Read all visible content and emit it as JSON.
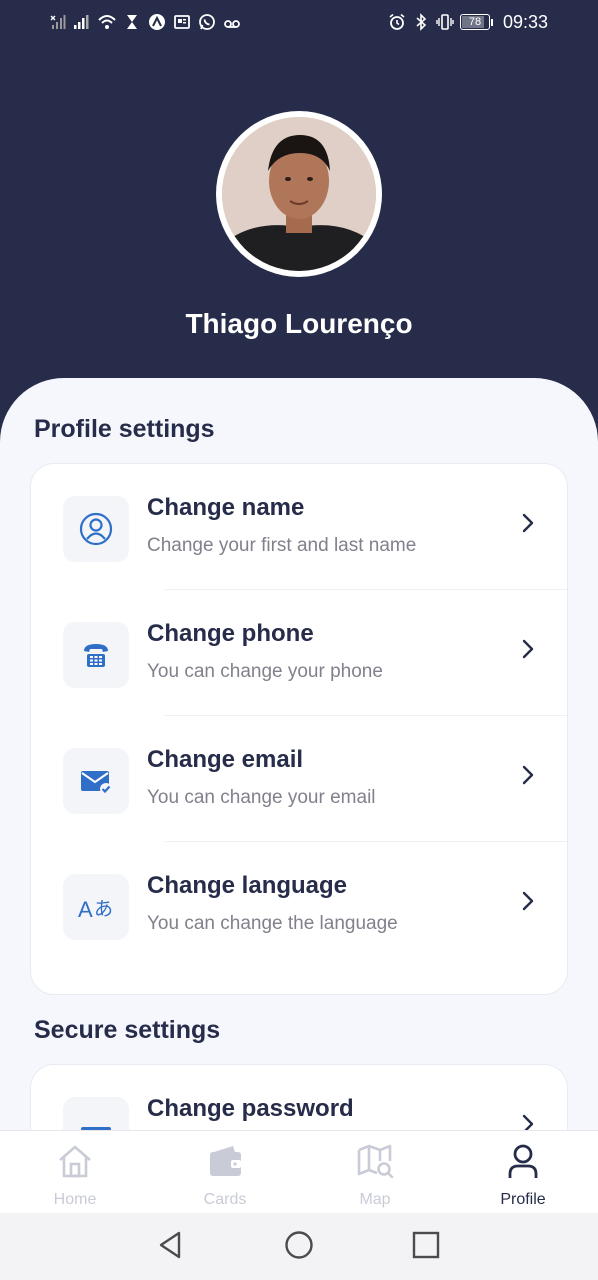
{
  "status_bar": {
    "time": "09:33",
    "battery": "78",
    "battery_level": 0.78,
    "left_icons": [
      "no-sim-signal-icon",
      "signal-icon",
      "wifi-icon",
      "hourglass-icon",
      "app-a-icon",
      "news-icon",
      "whatsapp-icon",
      "voicemail-icon"
    ],
    "right_icons": [
      "alarm-icon",
      "bluetooth-icon",
      "vibrate-icon",
      "battery-icon"
    ]
  },
  "profile": {
    "name": "Thiago Lourenço"
  },
  "profile_settings": {
    "title": "Profile settings",
    "items": [
      {
        "title": "Change name",
        "subtitle": "Change your first and last name",
        "icon": "user-icon"
      },
      {
        "title": "Change phone",
        "subtitle": "You can change your phone",
        "icon": "phone-icon"
      },
      {
        "title": "Change email",
        "subtitle": "You can change your email",
        "icon": "email-check-icon"
      },
      {
        "title": "Change language",
        "subtitle": "You can change the language",
        "icon": "translate-icon"
      }
    ]
  },
  "secure_settings": {
    "title": "Secure settings",
    "items": [
      {
        "title": "Change password",
        "icon": "password-icon"
      }
    ]
  },
  "bottom_nav": {
    "items": [
      {
        "label": "Home",
        "icon": "home-icon",
        "active": false
      },
      {
        "label": "Cards",
        "icon": "wallet-icon",
        "active": false
      },
      {
        "label": "Map",
        "icon": "map-search-icon",
        "active": false
      },
      {
        "label": "Profile",
        "icon": "person-icon",
        "active": true
      }
    ]
  },
  "colors": {
    "header_bg": "#262c49",
    "sheet_bg": "#f5f7fc",
    "accent": "#2f6fc7",
    "text_primary": "#262c49",
    "text_secondary": "#80818c",
    "nav_inactive": "#c9ccd6"
  }
}
